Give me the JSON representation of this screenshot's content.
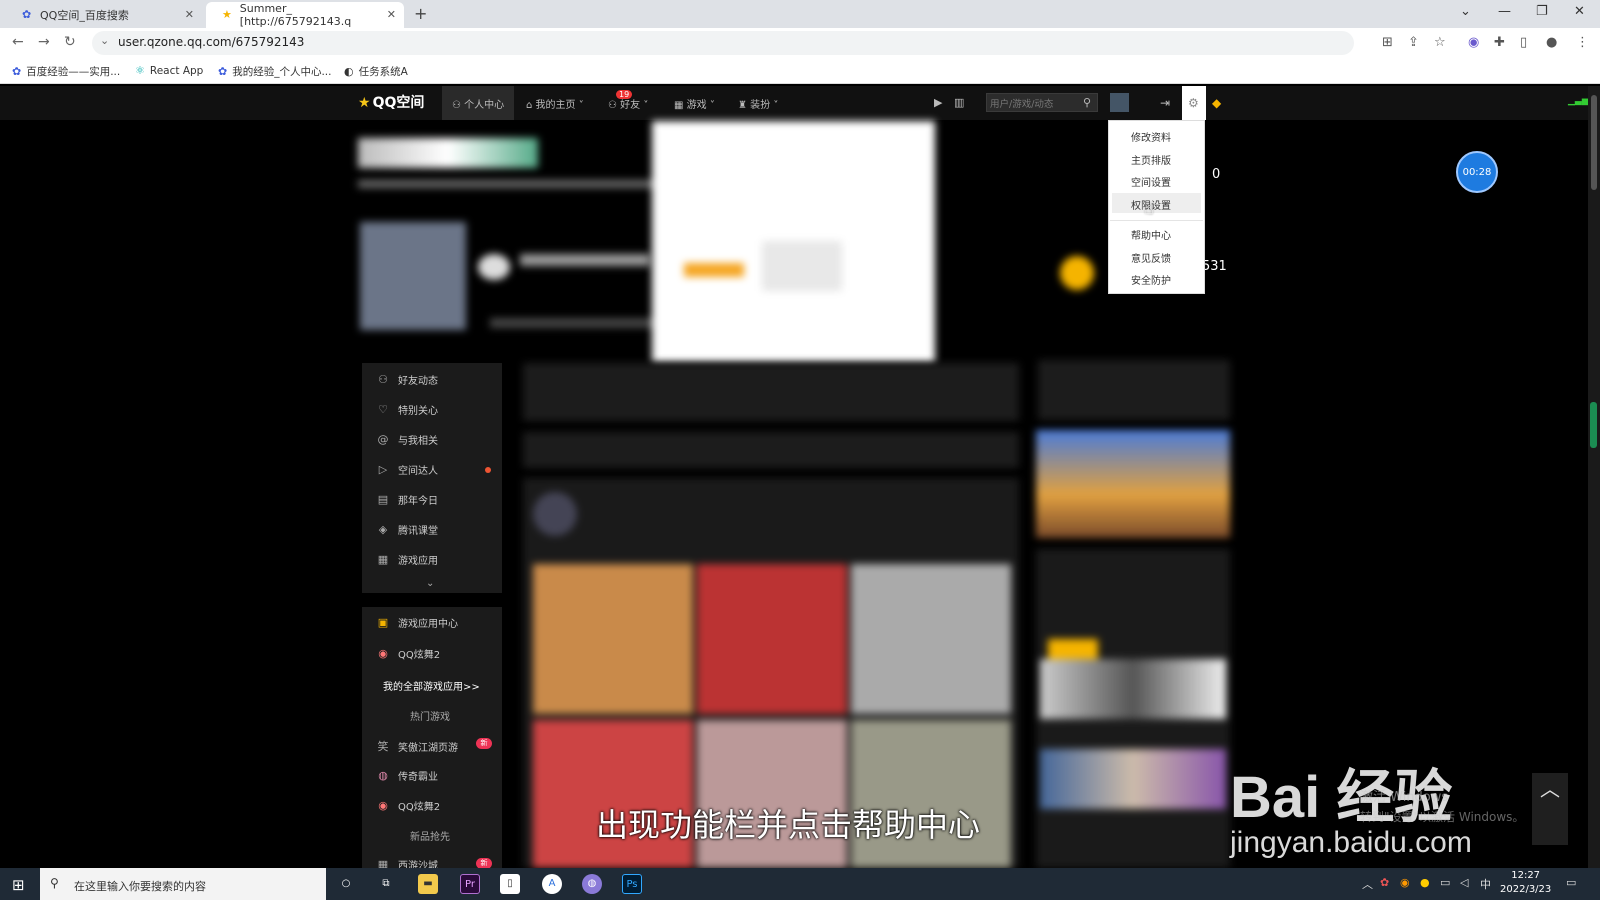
{
  "browser": {
    "tabs": [
      {
        "title": "QQ空间_百度搜索"
      },
      {
        "title": "Summer_ [http://675792143.q"
      }
    ],
    "url": "user.qzone.qq.com/675792143",
    "bookmarks": [
      "百度经验——实用...",
      "React App",
      "我的经验_个人中心...",
      "任务系统A"
    ]
  },
  "qzone_nav": {
    "logo": "QQ空间",
    "items": [
      "个人中心",
      "我的主页",
      "好友",
      "游戏",
      "装扮"
    ],
    "friends_badge": "19",
    "search_placeholder": "用户/游戏/动态"
  },
  "settings_menu": {
    "items": [
      "修改资料",
      "主页排版",
      "空间设置",
      "权限设置",
      "帮助中心",
      "意见反馈",
      "安全防护"
    ],
    "highlighted": "权限设置"
  },
  "stats": {
    "visits_today": "0",
    "total": "531"
  },
  "video_timer": "00:28",
  "sidebar": {
    "primary": [
      "好友动态",
      "特别关心",
      "与我相关",
      "空间达人",
      "那年今日",
      "腾讯课堂",
      "游戏应用"
    ],
    "games_header": "游戏应用中心",
    "games": [
      "QQ炫舞2"
    ],
    "all_games_link": "我的全部游戏应用>>",
    "hot_title": "热门游戏",
    "hot": [
      "笑傲江湖页游",
      "传奇霸业",
      "QQ炫舞2"
    ],
    "new_title": "新品抢先",
    "new": [
      "西游沙城"
    ]
  },
  "caption": "出现功能栏并点击帮助中心",
  "watermark": {
    "brand": "Bai  经验",
    "url": "jingyan.baidu.com",
    "activate_title": "激活 Windows",
    "activate_sub": "转到\"设置\"以激活 Windows。"
  },
  "taskbar": {
    "search_placeholder": "在这里输入你要搜索的内容",
    "time": "12:27",
    "date": "2022/3/23",
    "ime": "中"
  }
}
